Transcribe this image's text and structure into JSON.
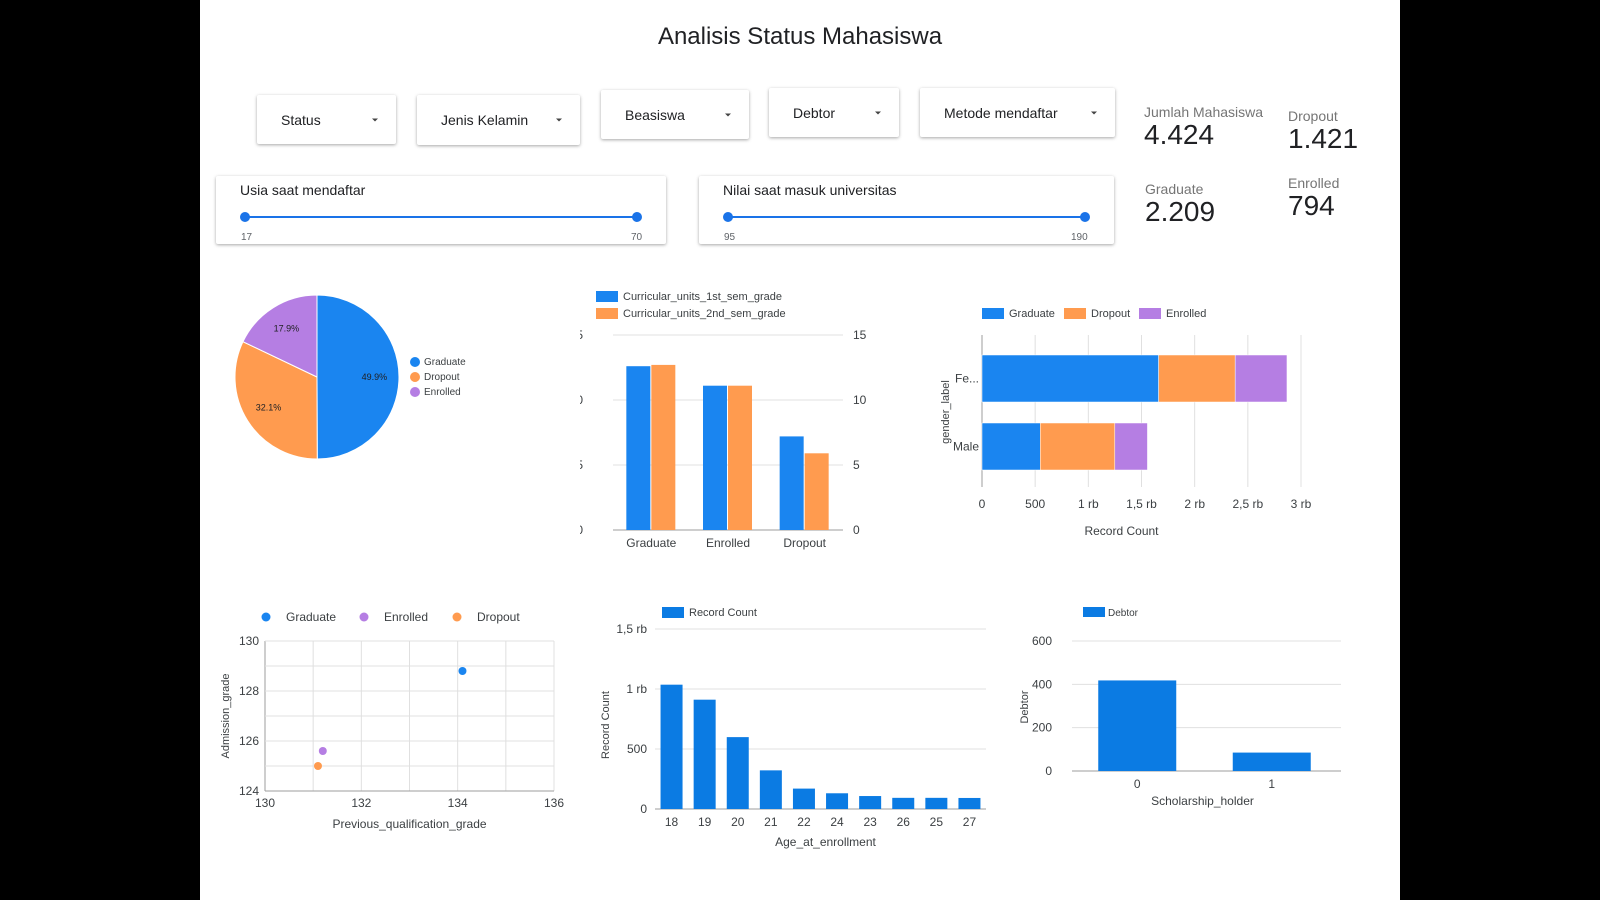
{
  "title": "Analisis Status Mahasiswa",
  "filters": {
    "status": "Status",
    "gender": "Jenis Kelamin",
    "scholarship": "Beasiswa",
    "debtor": "Debtor",
    "application_mode": "Metode mendaftar"
  },
  "sliders": {
    "age": {
      "title": "Usia saat mendaftar",
      "min": "17",
      "max": "70"
    },
    "grade": {
      "title": "Nilai saat masuk universitas",
      "min": "95",
      "max": "190"
    }
  },
  "kpis": {
    "total": {
      "label": "Jumlah Mahasiswa",
      "value": "4.424"
    },
    "dropout": {
      "label": "Dropout",
      "value": "1.421"
    },
    "graduate": {
      "label": "Graduate",
      "value": "2.209"
    },
    "enrolled": {
      "label": "Enrolled",
      "value": "794"
    }
  },
  "colors": {
    "blue": "#1a85f0",
    "orange": "#ff9b4f",
    "purple": "#b57ee3",
    "bar_blue": "#0b7be3"
  },
  "chart_data": [
    {
      "type": "pie",
      "labels": [
        "Graduate",
        "Dropout",
        "Enrolled"
      ],
      "values": [
        49.9,
        32.1,
        17.9
      ],
      "value_labels": [
        "49.9%",
        "32.1%",
        "17.9%"
      ],
      "legend": "right"
    },
    {
      "type": "bar",
      "categories": [
        "Graduate",
        "Enrolled",
        "Dropout"
      ],
      "series": [
        {
          "name": "Curricular_units_1st_sem_grade",
          "values": [
            12.6,
            11.1,
            7.2
          ]
        },
        {
          "name": "Curricular_units_2nd_sem_grade",
          "values": [
            12.7,
            11.1,
            5.9
          ]
        }
      ],
      "ylim": [
        0,
        15
      ],
      "yticks": [
        "0",
        "5",
        "10",
        "15"
      ],
      "legend": "top"
    },
    {
      "type": "bar",
      "orientation": "horizontal",
      "stacked": true,
      "categories": [
        "Fe...",
        "Male"
      ],
      "series": [
        {
          "name": "Graduate",
          "values": [
            1661,
            548
          ]
        },
        {
          "name": "Dropout",
          "values": [
            720,
            701
          ]
        },
        {
          "name": "Enrolled",
          "values": [
            487,
            307
          ]
        }
      ],
      "xlim": [
        0,
        3000
      ],
      "xticks": [
        "0",
        "500",
        "1 rb",
        "1,5 rb",
        "2 rb",
        "2,5 rb",
        "3 rb"
      ],
      "xlabel": "Record Count",
      "ylabel": "gender_label",
      "legend": "top"
    },
    {
      "type": "scatter",
      "series": [
        {
          "name": "Graduate",
          "x": [
            134.1
          ],
          "y": [
            128.8
          ]
        },
        {
          "name": "Enrolled",
          "x": [
            131.2
          ],
          "y": [
            125.6
          ]
        },
        {
          "name": "Dropout",
          "x": [
            131.1
          ],
          "y": [
            125.0
          ]
        }
      ],
      "xlim": [
        130,
        136
      ],
      "ylim": [
        124,
        130
      ],
      "xticks": [
        "130",
        "132",
        "134",
        "136"
      ],
      "yticks": [
        "124",
        "126",
        "128",
        "130"
      ],
      "xlabel": "Previous_qualification_grade",
      "ylabel": "Admission_grade",
      "legend": "top"
    },
    {
      "type": "bar",
      "categories": [
        "18",
        "19",
        "20",
        "21",
        "22",
        "24",
        "23",
        "26",
        "25",
        "27"
      ],
      "series": [
        {
          "name": "Record Count",
          "values": [
            1036,
            911,
            599,
            322,
            170,
            131,
            108,
            93,
            93,
            92
          ]
        }
      ],
      "ylim": [
        0,
        1500
      ],
      "yticks": [
        "0",
        "500",
        "1 rb",
        "1,5 rb"
      ],
      "xlabel": "Age_at_enrollment",
      "ylabel": "Record Count",
      "legend": "top"
    },
    {
      "type": "bar",
      "categories": [
        "0",
        "1"
      ],
      "series": [
        {
          "name": "Debtor",
          "values": [
            418,
            85
          ]
        }
      ],
      "ylim": [
        0,
        600
      ],
      "yticks": [
        "0",
        "200",
        "400",
        "600"
      ],
      "xlabel": "Scholarship_holder",
      "ylabel": "Debtor",
      "legend": "top"
    }
  ]
}
